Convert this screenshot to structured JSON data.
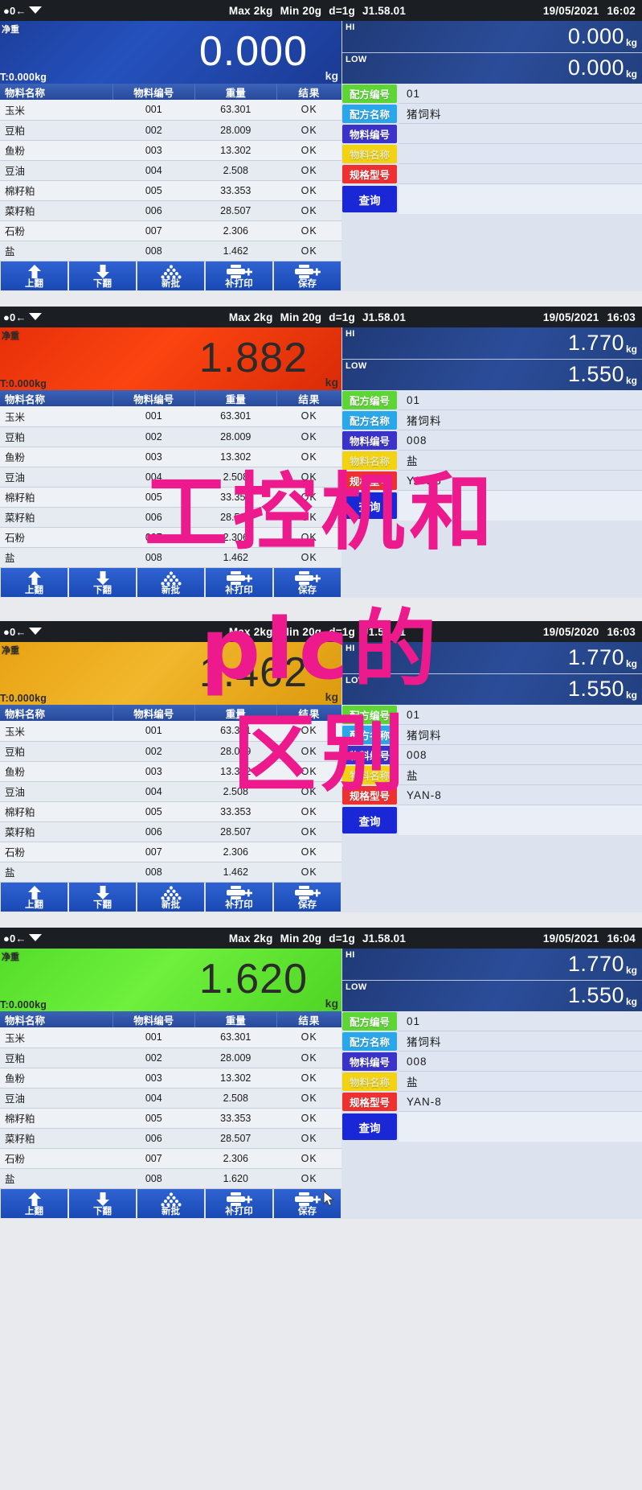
{
  "device": {
    "spec_line": [
      "Max 2kg",
      "Min 20g",
      "d=1g",
      "J1.58.01"
    ],
    "net_label": "净重",
    "tare_label": "T:0.000kg",
    "unit": "kg",
    "hi_tag": "HI",
    "low_tag": "LOW",
    "zero_icon": "zero-indicator",
    "stable_icon": "stable-indicator"
  },
  "table": {
    "headers": [
      "物料名称",
      "物料编号",
      "重量",
      "结果"
    ]
  },
  "form_labels": {
    "recipe_no": "配方编号",
    "recipe_name": "配方名称",
    "material_no": "物料编号",
    "material_name": "物料名称",
    "spec_model": "规格型号",
    "query": "查询"
  },
  "toolbar": {
    "buttons": [
      {
        "label": "上翻",
        "icon": "arrow-up-icon"
      },
      {
        "label": "下翻",
        "icon": "arrow-down-icon"
      },
      {
        "label": "新批",
        "icon": "stack-icon"
      },
      {
        "label": "补打印",
        "icon": "printer-plus-icon"
      },
      {
        "label": "保存",
        "icon": "printer-save-icon"
      }
    ]
  },
  "colors": {
    "recipe_no": "#5dd534",
    "recipe_name": "#2aa6ea",
    "material_no": "#3b33c9",
    "material_name": "#f2d211",
    "spec_model": "#ef3030",
    "query": "#1a27d6",
    "toolbar": "#1a49b4",
    "display_blue": "#2551bd",
    "display_red": "#fb4410",
    "display_amber": "#f2b72c",
    "display_green": "#6ef03c"
  },
  "panels": [
    {
      "date": "19/05/2021",
      "time": "16:02",
      "display_state": "blue",
      "weight": "0.000",
      "hi": "0.000",
      "low": "0.000",
      "rows": [
        {
          "name": "玉米",
          "code": "001",
          "weight": "63.301",
          "result": "OK"
        },
        {
          "name": "豆粕",
          "code": "002",
          "weight": "28.009",
          "result": "OK"
        },
        {
          "name": "鱼粉",
          "code": "003",
          "weight": "13.302",
          "result": "OK"
        },
        {
          "name": "豆油",
          "code": "004",
          "weight": "2.508",
          "result": "OK"
        },
        {
          "name": "棉籽粕",
          "code": "005",
          "weight": "33.353",
          "result": "OK"
        },
        {
          "name": "菜籽粕",
          "code": "006",
          "weight": "28.507",
          "result": "OK"
        },
        {
          "name": "石粉",
          "code": "007",
          "weight": "2.306",
          "result": "OK"
        },
        {
          "name": "盐",
          "code": "008",
          "weight": "1.462",
          "result": "OK"
        }
      ],
      "fields": {
        "recipe_no": "01",
        "recipe_name": "猪饲料",
        "material_no": "",
        "material_name": "",
        "spec_model": ""
      },
      "cursor_on": "material-name-label"
    },
    {
      "date": "19/05/2021",
      "time": "16:03",
      "display_state": "red",
      "weight": "1.882",
      "hi": "1.770",
      "low": "1.550",
      "rows": [
        {
          "name": "玉米",
          "code": "001",
          "weight": "63.301",
          "result": "OK"
        },
        {
          "name": "豆粕",
          "code": "002",
          "weight": "28.009",
          "result": "OK"
        },
        {
          "name": "鱼粉",
          "code": "003",
          "weight": "13.302",
          "result": "OK"
        },
        {
          "name": "豆油",
          "code": "004",
          "weight": "2.508",
          "result": "OK"
        },
        {
          "name": "棉籽粕",
          "code": "005",
          "weight": "33.353",
          "result": "OK"
        },
        {
          "name": "菜籽粕",
          "code": "006",
          "weight": "28.507",
          "result": "OK"
        },
        {
          "name": "石粉",
          "code": "007",
          "weight": "2.306",
          "result": "OK"
        },
        {
          "name": "盐",
          "code": "008",
          "weight": "1.462",
          "result": "OK"
        }
      ],
      "fields": {
        "recipe_no": "01",
        "recipe_name": "猪饲料",
        "material_no": "008",
        "material_name": "盐",
        "spec_model": "YAN-8"
      },
      "cursor_on": ""
    },
    {
      "date": "19/05/2020",
      "time": "16:03",
      "display_state": "amber",
      "weight": "1.462",
      "hi": "1.770",
      "low": "1.550",
      "rows": [
        {
          "name": "玉米",
          "code": "001",
          "weight": "63.301",
          "result": "OK"
        },
        {
          "name": "豆粕",
          "code": "002",
          "weight": "28.009",
          "result": "OK"
        },
        {
          "name": "鱼粉",
          "code": "003",
          "weight": "13.302",
          "result": "OK"
        },
        {
          "name": "豆油",
          "code": "004",
          "weight": "2.508",
          "result": "OK"
        },
        {
          "name": "棉籽粕",
          "code": "005",
          "weight": "33.353",
          "result": "OK"
        },
        {
          "name": "菜籽粕",
          "code": "006",
          "weight": "28.507",
          "result": "OK"
        },
        {
          "name": "石粉",
          "code": "007",
          "weight": "2.306",
          "result": "OK"
        },
        {
          "name": "盐",
          "code": "008",
          "weight": "1.462",
          "result": "OK"
        }
      ],
      "fields": {
        "recipe_no": "01",
        "recipe_name": "猪饲料",
        "material_no": "008",
        "material_name": "盐",
        "spec_model": "YAN-8"
      },
      "cursor_on": ""
    },
    {
      "date": "19/05/2021",
      "time": "16:04",
      "display_state": "green",
      "weight": "1.620",
      "hi": "1.770",
      "low": "1.550",
      "rows": [
        {
          "name": "玉米",
          "code": "001",
          "weight": "63.301",
          "result": "OK"
        },
        {
          "name": "豆粕",
          "code": "002",
          "weight": "28.009",
          "result": "OK"
        },
        {
          "name": "鱼粉",
          "code": "003",
          "weight": "13.302",
          "result": "OK"
        },
        {
          "name": "豆油",
          "code": "004",
          "weight": "2.508",
          "result": "OK"
        },
        {
          "name": "棉籽粕",
          "code": "005",
          "weight": "33.353",
          "result": "OK"
        },
        {
          "name": "菜籽粕",
          "code": "006",
          "weight": "28.507",
          "result": "OK"
        },
        {
          "name": "石粉",
          "code": "007",
          "weight": "2.306",
          "result": "OK"
        },
        {
          "name": "盐",
          "code": "008",
          "weight": "1.620",
          "result": "OK"
        }
      ],
      "fields": {
        "recipe_no": "01",
        "recipe_name": "猪饲料",
        "material_no": "008",
        "material_name": "盐",
        "spec_model": "YAN-8"
      },
      "cursor_on": "save-button"
    }
  ],
  "watermark": {
    "line1": "工控机和",
    "line2": "plc的",
    "line3": "区别",
    "color": "#ec1a8c"
  }
}
